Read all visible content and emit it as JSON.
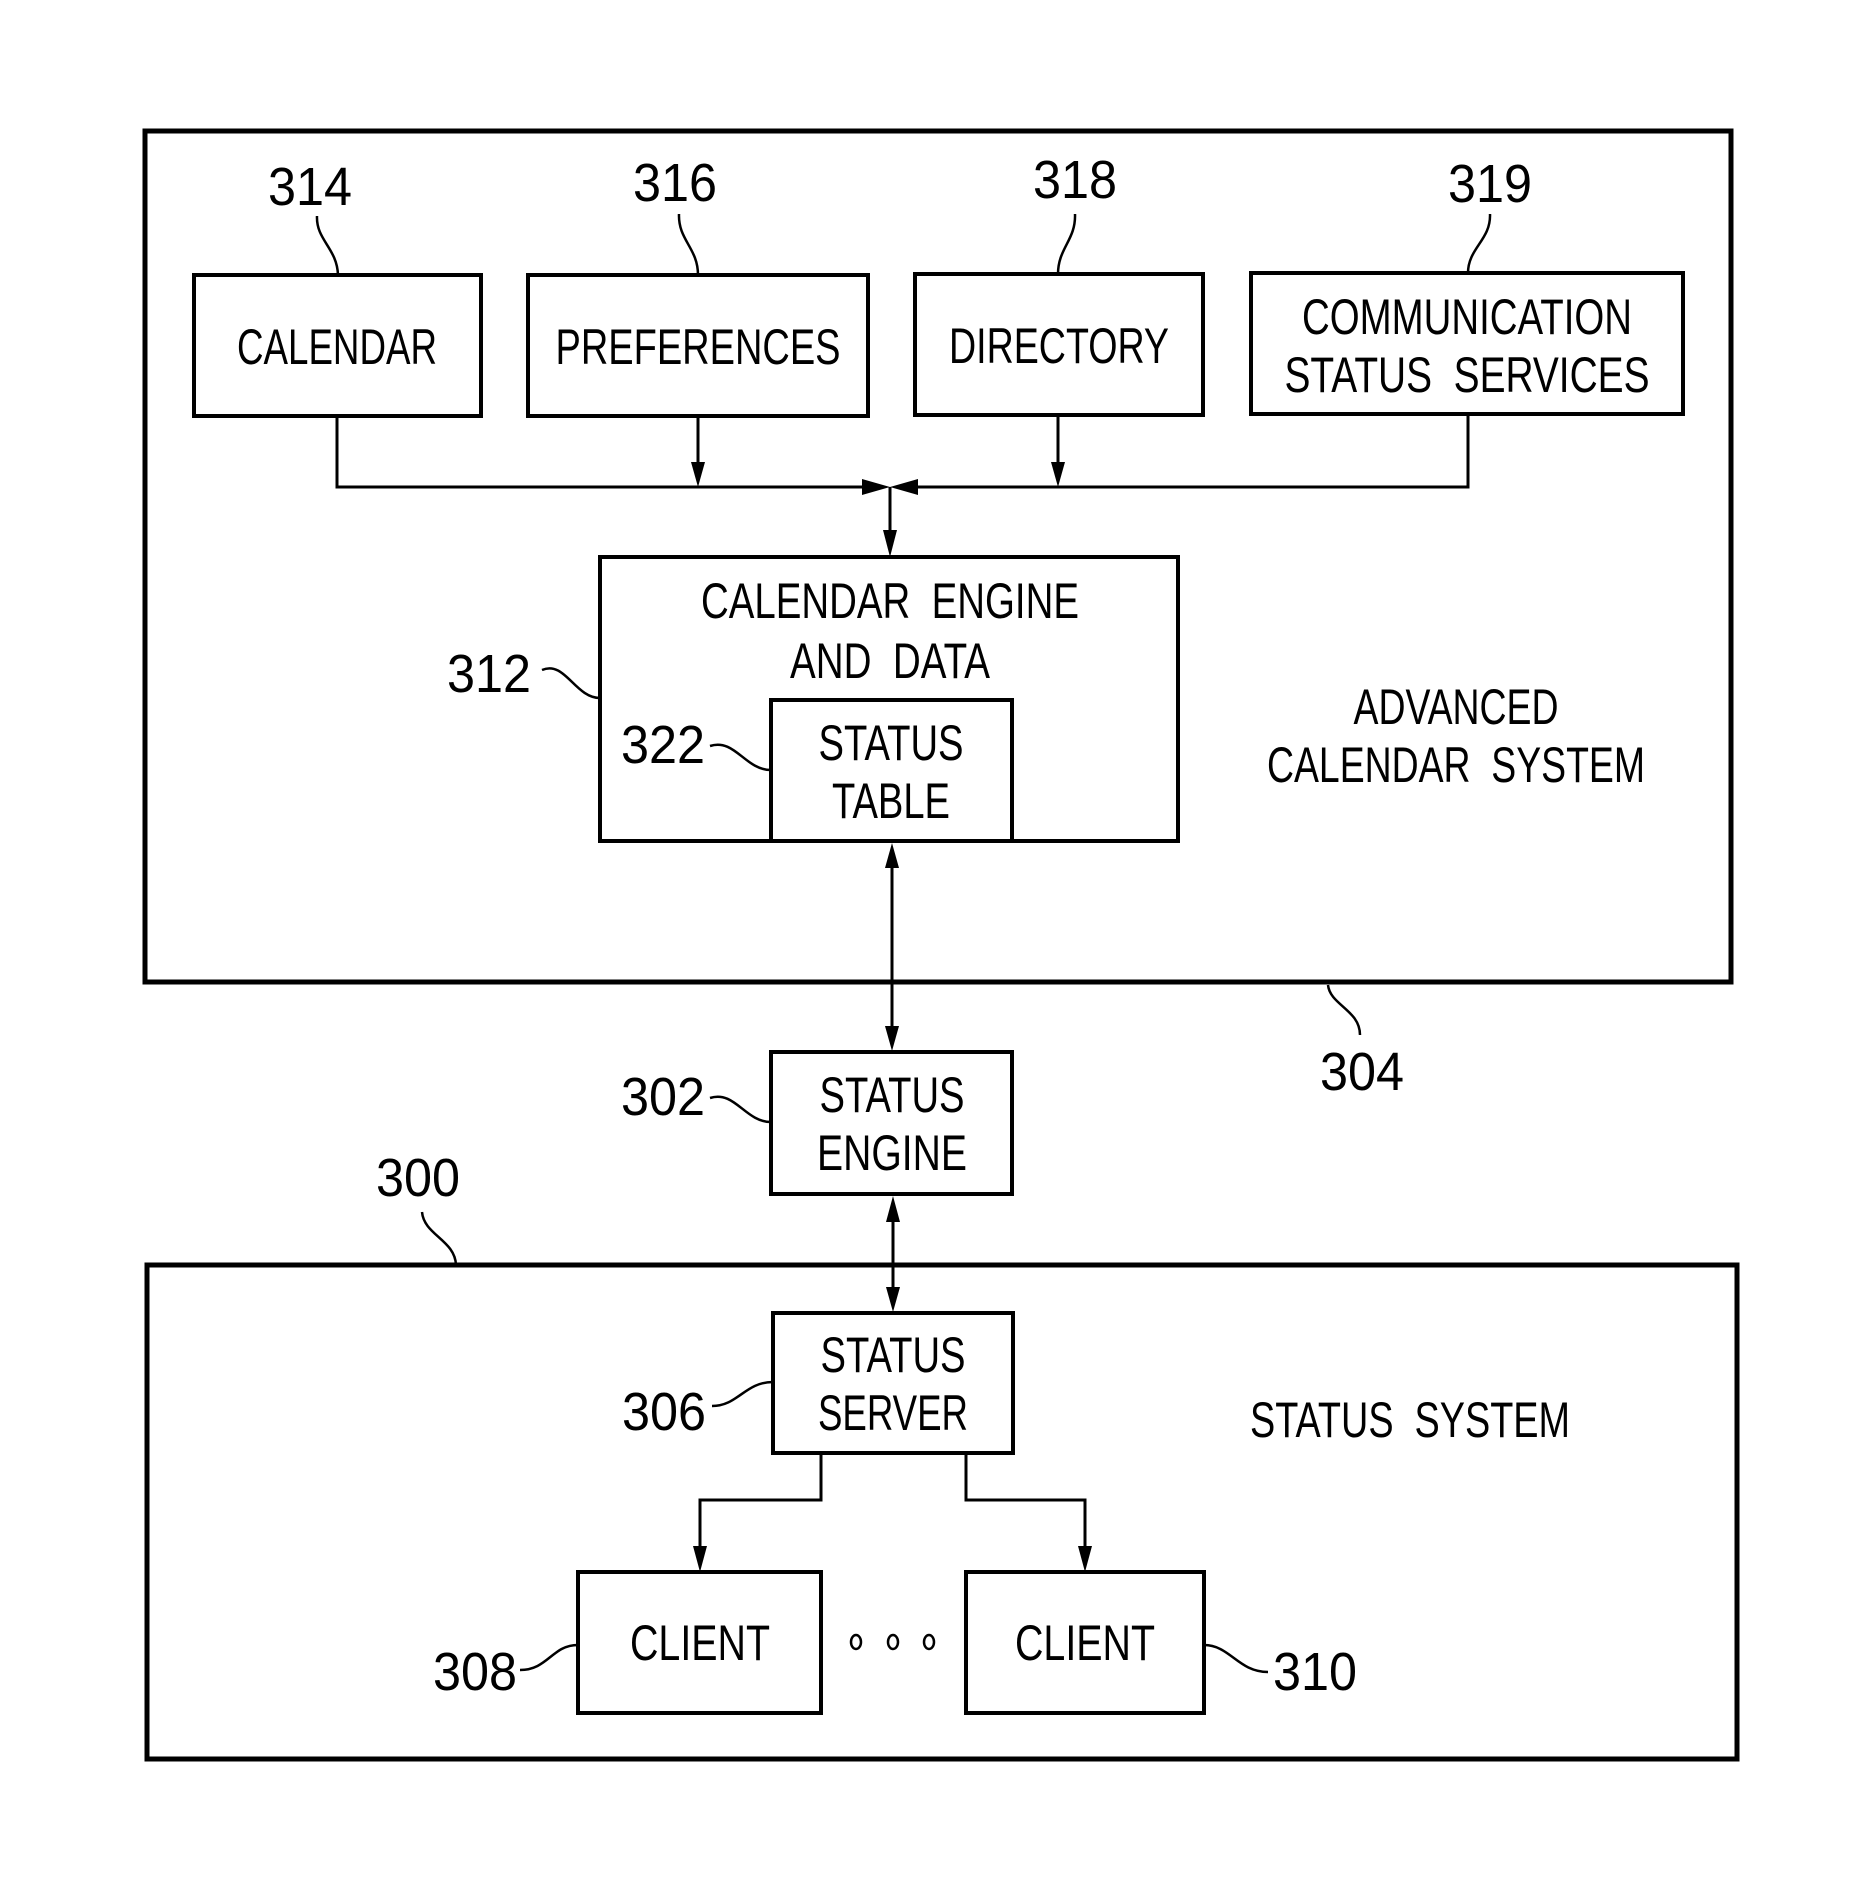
{
  "figure": {
    "systems": {
      "advanced_calendar": {
        "ref": "304",
        "label_lines": [
          "ADVANCED",
          "CALENDAR  SYSTEM"
        ]
      },
      "status_system": {
        "ref": "300",
        "label_lines": [
          "STATUS  SYSTEM"
        ]
      }
    },
    "blocks": {
      "calendar": {
        "ref": "314",
        "lines": [
          "CALENDAR"
        ]
      },
      "preferences": {
        "ref": "316",
        "lines": [
          "PREFERENCES"
        ]
      },
      "directory": {
        "ref": "318",
        "lines": [
          "DIRECTORY"
        ]
      },
      "comm_status": {
        "ref": "319",
        "lines": [
          "COMMUNICATION",
          "STATUS  SERVICES"
        ]
      },
      "calendar_engine": {
        "ref": "312",
        "lines": [
          "CALENDAR  ENGINE",
          "AND  DATA"
        ]
      },
      "status_table": {
        "ref": "322",
        "lines": [
          "STATUS",
          "TABLE"
        ]
      },
      "status_engine": {
        "ref": "302",
        "lines": [
          "STATUS",
          "ENGINE"
        ]
      },
      "status_server": {
        "ref": "306",
        "lines": [
          "STATUS",
          "SERVER"
        ]
      },
      "client_1": {
        "ref": "308",
        "lines": [
          "CLIENT"
        ]
      },
      "client_n": {
        "ref": "310",
        "lines": [
          "CLIENT"
        ]
      }
    },
    "ellipsis": "• • •"
  }
}
